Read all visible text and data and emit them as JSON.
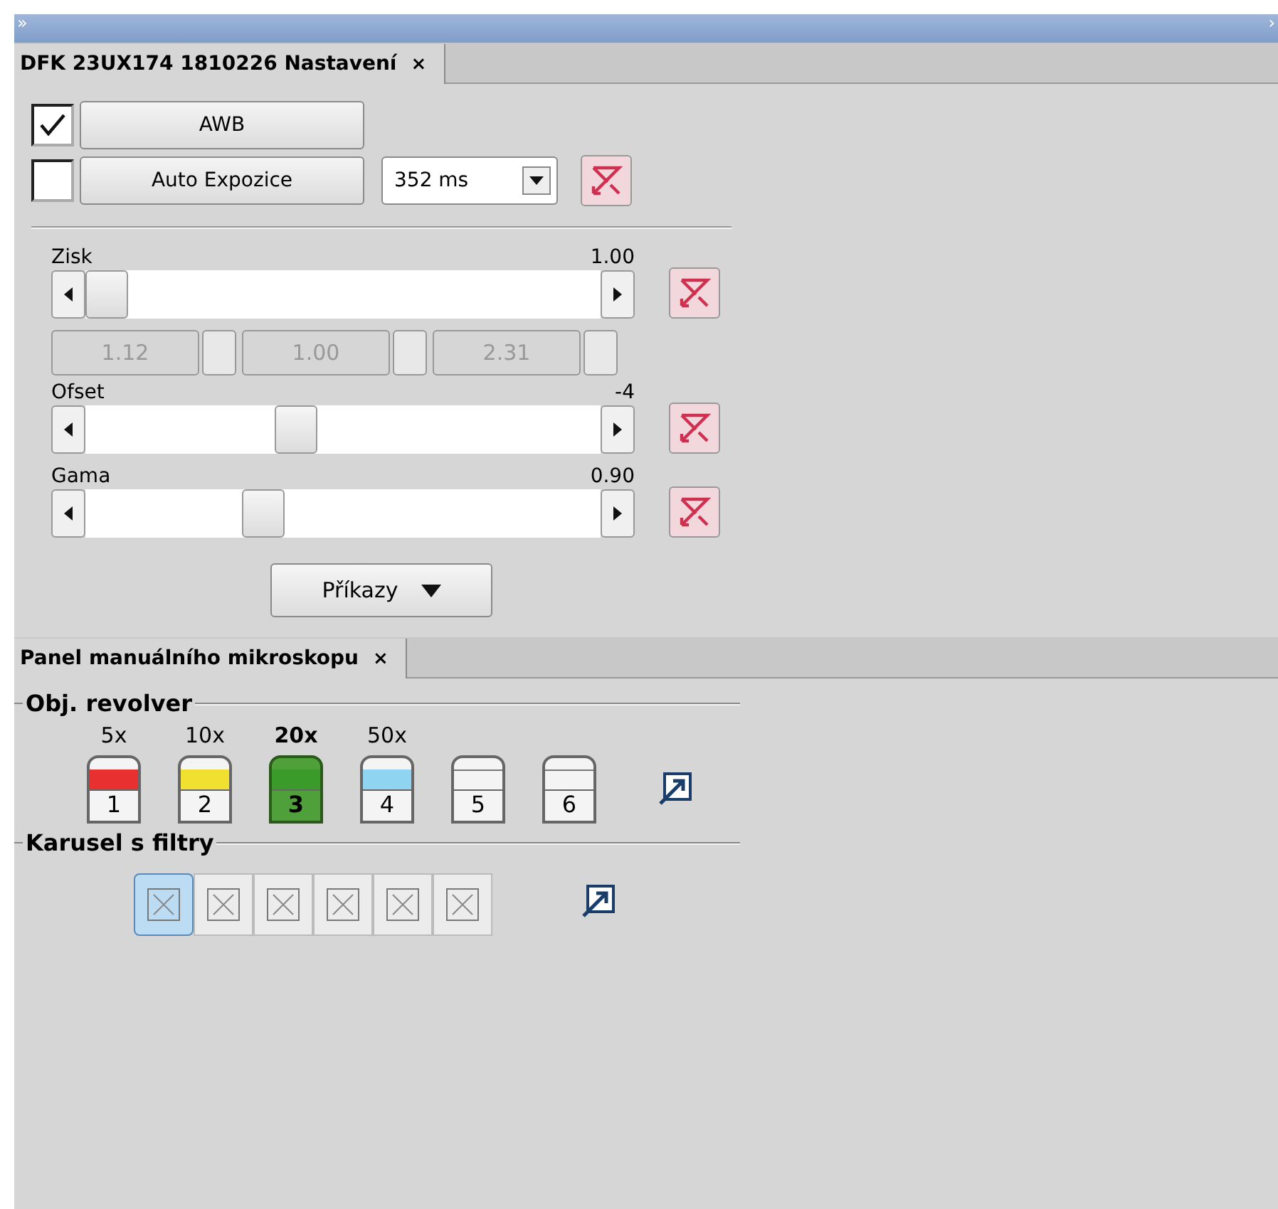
{
  "top_bar": {
    "left_glyph": "»",
    "right_glyph": "›"
  },
  "settings_tab": {
    "title": "DFK 23UX174 1810226 Nastavení",
    "close": "×",
    "selected": true
  },
  "auto_rows": [
    {
      "kind": "button",
      "checked": true,
      "label": "AWB"
    },
    {
      "kind": "exposure",
      "checked": false,
      "label": "Auto Expozice",
      "value": "352 ms"
    }
  ],
  "sliders": [
    {
      "label": "Zisk",
      "reading": "1.00",
      "level": 0.0,
      "spins": [
        "1.12",
        "1.00",
        "2.31"
      ]
    },
    {
      "label": "Ofset",
      "reading": "-4",
      "level": 0.4
    },
    {
      "label": "Gama",
      "reading": "0.90",
      "level": 0.33
    }
  ],
  "commands_button": {
    "label": "Příkazy"
  },
  "microscope_tab": {
    "title": "Panel manuálního mikroskopu",
    "close": "×",
    "selected": true
  },
  "revolver": {
    "title": "Obj. revolver",
    "objectives": [
      {
        "label": "5x",
        "number": "1",
        "color": "#e83030",
        "selected": false
      },
      {
        "label": "10x",
        "number": "2",
        "color": "#f2e030",
        "selected": false
      },
      {
        "label": "20x",
        "number": "3",
        "color": "#3a9a2a",
        "selected": true
      },
      {
        "label": "50x",
        "number": "4",
        "color": "#8fd4f0",
        "selected": false
      },
      {
        "number": "5",
        "selected": false
      },
      {
        "number": "6",
        "selected": false
      }
    ]
  },
  "filters": {
    "title": "Karusel s filtry",
    "slots": [
      {
        "selected": true
      },
      {
        "selected": false
      },
      {
        "selected": false
      },
      {
        "selected": false
      },
      {
        "selected": false
      },
      {
        "selected": false
      }
    ]
  }
}
